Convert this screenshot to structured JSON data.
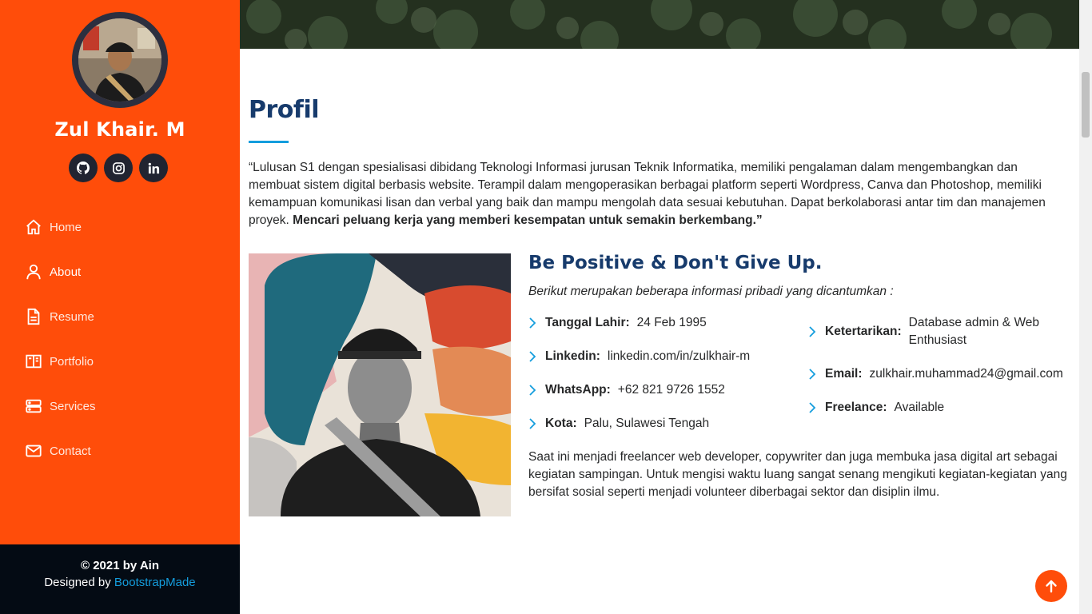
{
  "sidebar": {
    "name": "Zul Khair. M",
    "social": [
      {
        "icon": "github-icon"
      },
      {
        "icon": "instagram-icon"
      },
      {
        "icon": "linkedin-icon"
      }
    ],
    "nav": [
      {
        "label": "Home",
        "icon": "home-icon"
      },
      {
        "label": "About",
        "icon": "person-icon"
      },
      {
        "label": "Resume",
        "icon": "file-icon"
      },
      {
        "label": "Portfolio",
        "icon": "book-icon"
      },
      {
        "label": "Services",
        "icon": "server-icon"
      },
      {
        "label": "Contact",
        "icon": "envelope-icon"
      }
    ],
    "active_nav": "About",
    "footer": {
      "copyright": "© 2021 by Ain",
      "designed_by": "Designed by",
      "designer_link": "BootstrapMade"
    }
  },
  "about": {
    "title": "Profil",
    "intro": "“Lulusan S1 dengan spesialisasi dibidang Teknologi Informasi jurusan Teknik Informatika, memiliki pengalaman dalam mengembangkan dan membuat sistem digital berbasis website. Terampil dalam mengoperasikan berbagai platform seperti Wordpress, Canva dan Photoshop, memiliki kemampuan komunikasi lisan dan verbal yang baik dan mampu mengolah data sesuai kebutuhan. Dapat berkolaborasi antar tim dan manajemen proyek.",
    "intro_bold": "Mencari peluang kerja yang memberi kesempatan untuk semakin berkembang.”",
    "subtitle": "Be Positive & Don't Give Up.",
    "sub_intro": "Berikut merupakan beberapa informasi pribadi yang dicantumkan :",
    "info_left": [
      {
        "label": "Tanggal Lahir:",
        "value": "24 Feb 1995"
      },
      {
        "label": "Linkedin:",
        "value": "linkedin.com/in/zulkhair-m"
      },
      {
        "label": "WhatsApp:",
        "value": "+62 821 9726 1552"
      },
      {
        "label": "Kota:",
        "value": "Palu, Sulawesi Tengah"
      }
    ],
    "info_right": [
      {
        "label": "Ketertarikan:",
        "value": "Database admin & Web Enthusiast"
      },
      {
        "label": "Email:",
        "value": "zulkhair.muhammad24@gmail.com"
      },
      {
        "label": "Freelance:",
        "value": "Available"
      }
    ],
    "outro": "Saat ini menjadi freelancer web developer, copywriter dan juga membuka jasa digital art sebagai kegiatan sampingan. Untuk mengisi waktu luang sangat senang mengikuti kegiatan-kegiatan yang bersifat sosial seperti menjadi volunteer diberbagai sektor dan disiplin ilmu."
  },
  "colors": {
    "sidebar": "#ff4d0a",
    "heading": "#173b6c",
    "accent": "#149ddd",
    "footer_bg": "#040b14"
  },
  "back_to_top_icon": "arrow-up-icon"
}
